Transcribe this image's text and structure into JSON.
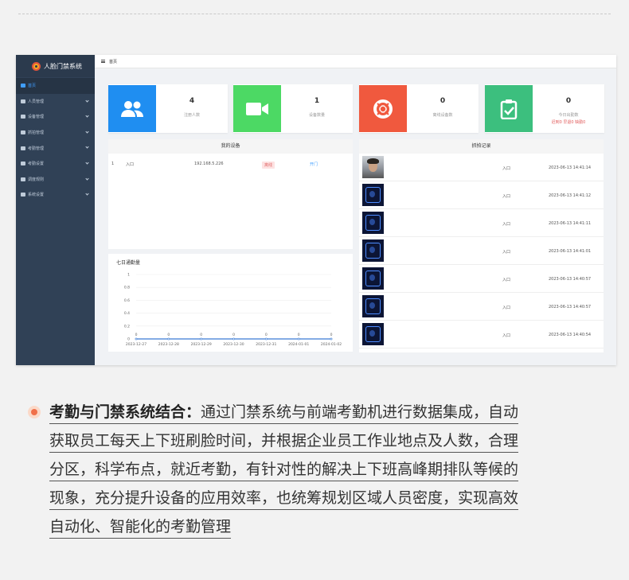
{
  "app": {
    "title": "人脸门禁系统"
  },
  "sidebar": {
    "items": [
      {
        "label": "首页",
        "icon": "home-icon"
      },
      {
        "label": "人员管理",
        "icon": "users-icon"
      },
      {
        "label": "设备管理",
        "icon": "camera-icon"
      },
      {
        "label": "抓拍管理",
        "icon": "snapshot-icon"
      },
      {
        "label": "考勤管理",
        "icon": "clock-icon"
      },
      {
        "label": "考勤设置",
        "icon": "settings-icon"
      },
      {
        "label": "调度规则",
        "icon": "rule-icon"
      },
      {
        "label": "系统设置",
        "icon": "gear-icon"
      }
    ]
  },
  "breadcrumb": "首页",
  "cards": [
    {
      "value": "4",
      "label": "注册人数",
      "color": "#1f8ef1",
      "icon": "users-icon"
    },
    {
      "value": "1",
      "label": "设备数量",
      "color": "#4cd964",
      "icon": "video-icon"
    },
    {
      "value": "0",
      "label": "离线设备数",
      "color": "#f0593e",
      "icon": "lifebuoy-icon"
    },
    {
      "value": "0",
      "label": "今日出勤数",
      "color": "#3cbf7e",
      "icon": "clipboard-check-icon",
      "sub": "迟到0 早退0 缺勤0"
    }
  ],
  "devices": {
    "title": "我的设备",
    "rows": [
      {
        "no": "1",
        "name": "入口",
        "ip": "192.168.5.226",
        "status": "离线",
        "action": "开门"
      }
    ]
  },
  "chart_data": {
    "type": "line",
    "title": "七日通勤量",
    "x": [
      "2023-12-27",
      "2023-12-28",
      "2023-12-29",
      "2023-12-30",
      "2023-12-31",
      "2024-01-01",
      "2024-01-02"
    ],
    "y_ticks": [
      "1",
      "0.8",
      "0.6",
      "0.4",
      "0.2",
      "0"
    ],
    "values": [
      0,
      0,
      0,
      0,
      0,
      0,
      0
    ],
    "ylim": [
      0,
      1
    ],
    "grid": true
  },
  "captures": {
    "title": "抓拍记录",
    "rows": [
      {
        "door": "入口",
        "time": "2023-06-13 14:41:14",
        "thumb": "face"
      },
      {
        "door": "入口",
        "time": "2023-06-13 14:41:12",
        "thumb": "dark"
      },
      {
        "door": "入口",
        "time": "2023-06-13 14:41:11",
        "thumb": "dark"
      },
      {
        "door": "入口",
        "time": "2023-06-13 14:41:01",
        "thumb": "dark"
      },
      {
        "door": "入口",
        "time": "2023-06-13 14:40:57",
        "thumb": "dark"
      },
      {
        "door": "入口",
        "time": "2023-06-13 14:40:57",
        "thumb": "dark"
      },
      {
        "door": "入口",
        "time": "2023-06-13 14:40:54",
        "thumb": "dark"
      }
    ]
  },
  "article": {
    "heading": "考勤与门禁系统结合：",
    "lines": [
      "通过门禁系统与前端考勤机进行数据集成，自动",
      "获取员工每天上下班刷脸时间，并根据企业员工作业地点及人数，合理",
      "分区，科学布点，就近考勤，有针对性的解决上下班高峰期排队等候的",
      "现象，充分提升设备的应用效率，也统筹规划区域人员密度，实现高效",
      "自动化、智能化的考勤管理"
    ]
  }
}
